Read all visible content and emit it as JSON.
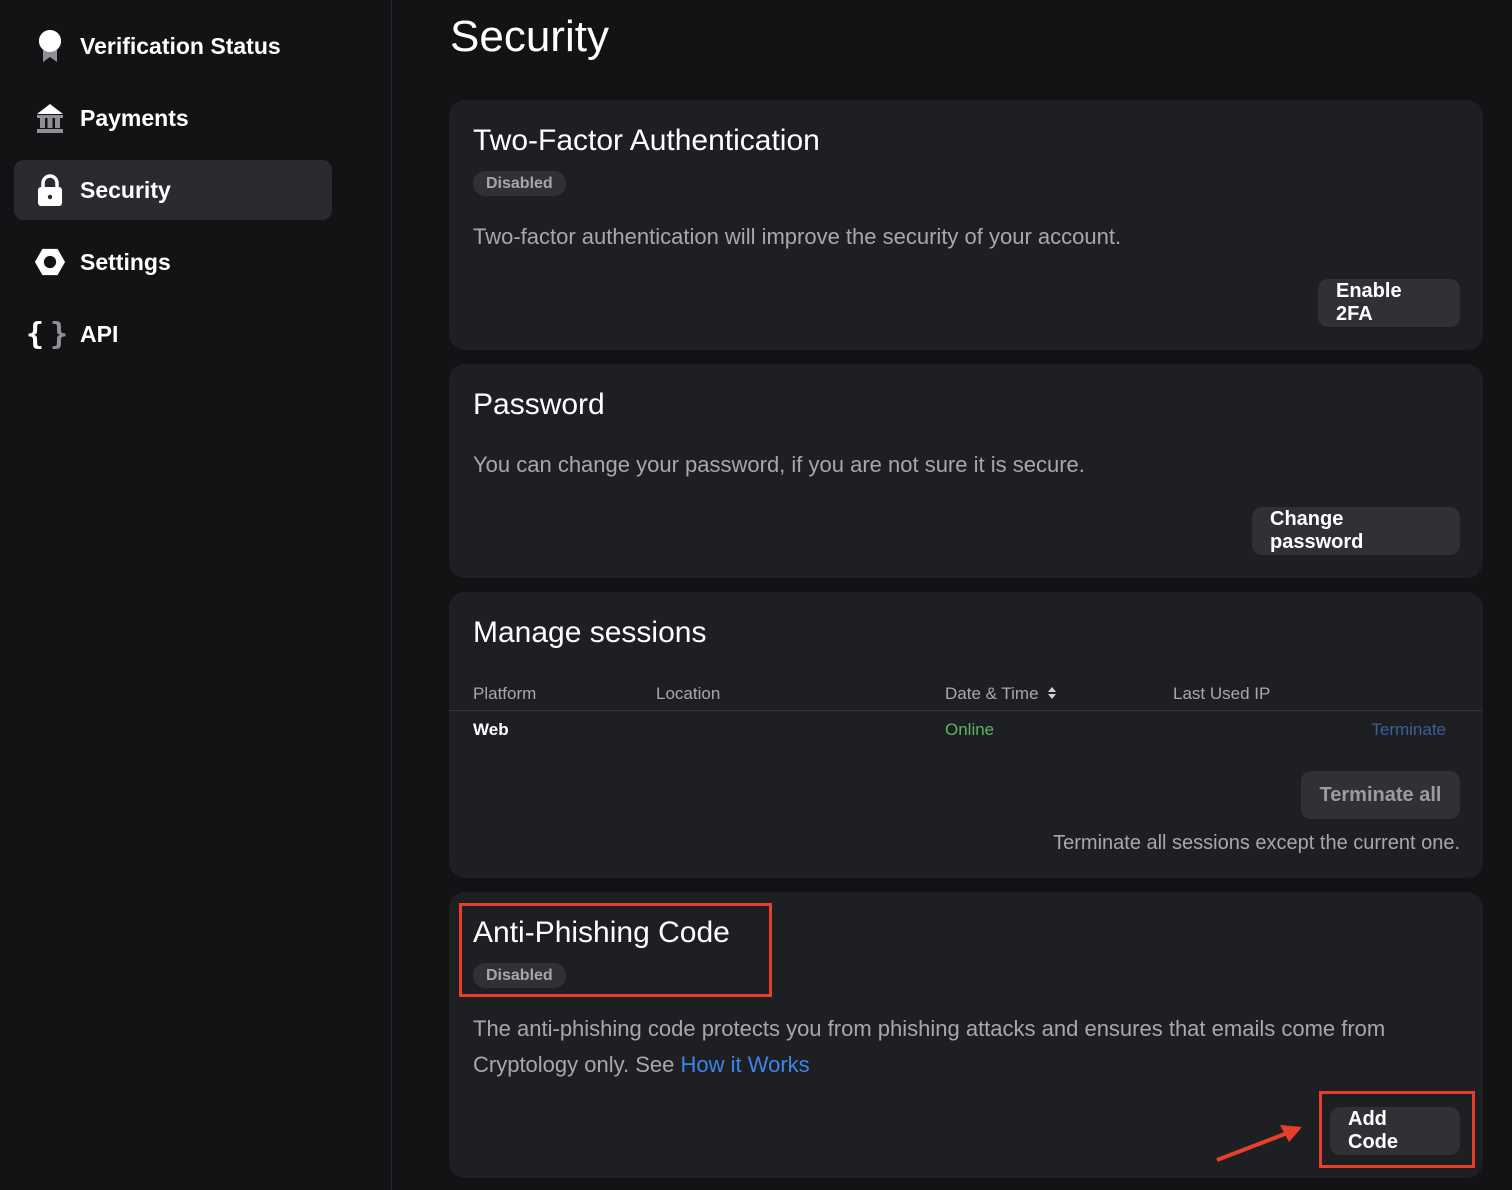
{
  "sidebar": {
    "items": [
      {
        "label": "Verification Status",
        "icon": "award-icon"
      },
      {
        "label": "Payments",
        "icon": "bank-icon"
      },
      {
        "label": "Security",
        "icon": "lock-icon",
        "active": true
      },
      {
        "label": "Settings",
        "icon": "gear-icon"
      },
      {
        "label": "API",
        "icon": "braces-icon"
      }
    ]
  },
  "page": {
    "title": "Security"
  },
  "two_factor": {
    "title": "Two-Factor Authentication",
    "badge": "Disabled",
    "description": "Two-factor authentication will improve the security of your account.",
    "button": "Enable 2FA"
  },
  "password": {
    "title": "Password",
    "description": "You can change your password, if you are not sure it is secure.",
    "button": "Change password"
  },
  "sessions": {
    "title": "Manage sessions",
    "columns": [
      "Platform",
      "Location",
      "Date & Time",
      "Last Used IP"
    ],
    "rows": [
      {
        "platform": "Web",
        "location": "",
        "datetime": "Online",
        "ip": "",
        "action": "Terminate"
      }
    ],
    "terminate_all": "Terminate all",
    "note": "Terminate all sessions except the current one."
  },
  "anti_phishing": {
    "title": "Anti-Phishing Code",
    "badge": "Disabled",
    "description": "The anti-phishing code protects you from phishing attacks and ensures that emails come from Cryptology only. See",
    "link": "How it Works",
    "button": "Add Code"
  },
  "colors": {
    "background": "#131316",
    "card": "#1e1f23",
    "online": "#5bb462",
    "link": "#3d84e6",
    "annotation": "#e6402d"
  }
}
